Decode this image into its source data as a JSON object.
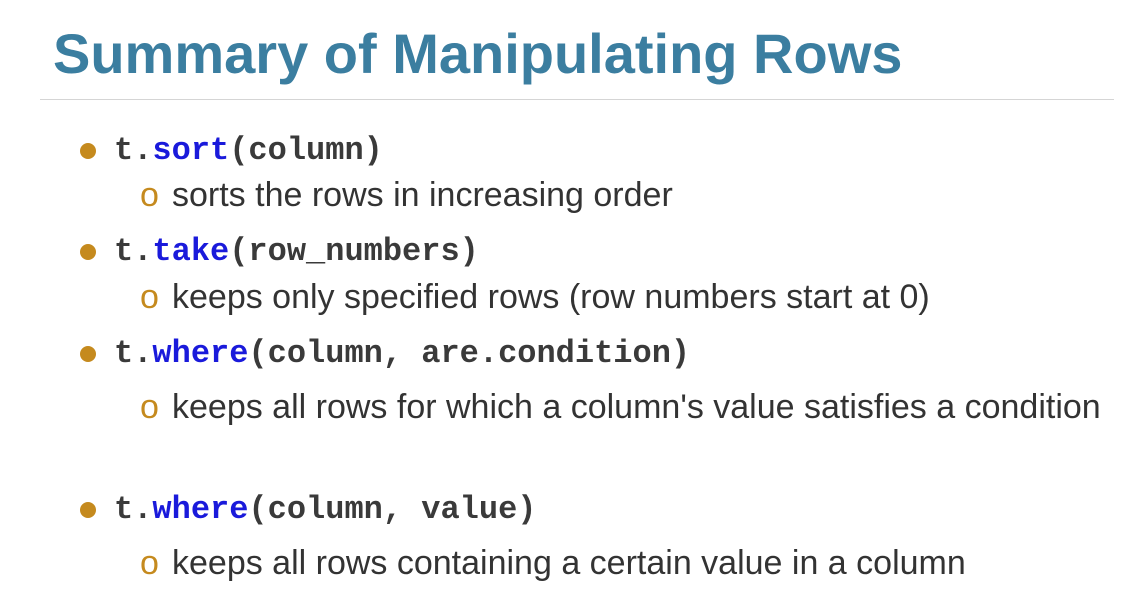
{
  "slide": {
    "title": "Summary of Manipulating Rows",
    "sub_marker": "o",
    "colors": {
      "title": "#3b7ea0",
      "bullet": "#c58a1e",
      "method": "#1a1adb",
      "code": "#3a3a3a",
      "text": "#333333"
    },
    "items": [
      {
        "prefix": "t.",
        "method": "sort",
        "args": "(column)",
        "description": "sorts the rows in increasing order"
      },
      {
        "prefix": "t.",
        "method": "take",
        "args": "(row_numbers)",
        "description": "keeps only specified rows (row numbers start at 0)"
      },
      {
        "prefix": "t.",
        "method": "where",
        "args": "(column, are.condition)",
        "description": "keeps all rows for which a column's value satisfies a condition"
      },
      {
        "prefix": "t.",
        "method": "where",
        "args": "(column, value)",
        "description": "keeps all rows containing a certain value in a column"
      }
    ]
  }
}
